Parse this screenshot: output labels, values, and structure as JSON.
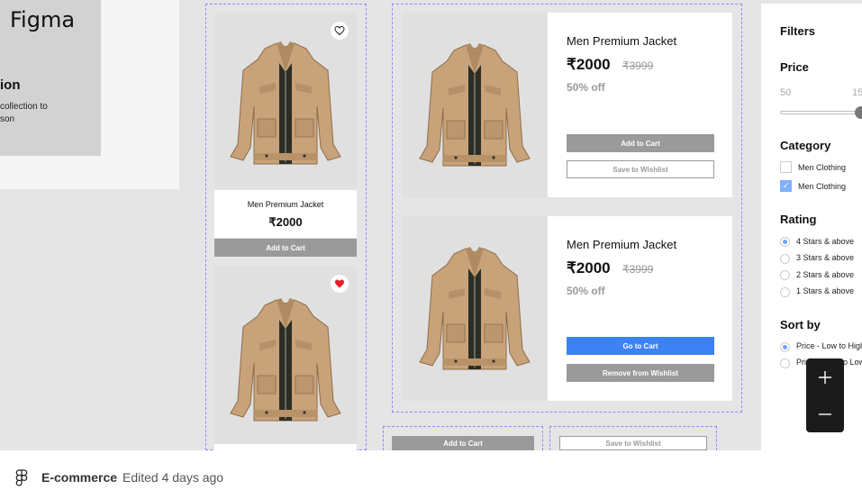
{
  "hero": {
    "logo": "Figma",
    "title": "ion",
    "line1": "collection to",
    "line2": "son"
  },
  "product_grid": {
    "cards": [
      {
        "name": "Men Premium Jacket",
        "price": "₹2000",
        "button": "Add to Cart",
        "favorite": false
      },
      {
        "name": "",
        "price": "",
        "button": "",
        "favorite": true
      }
    ]
  },
  "wishlist": {
    "cards": [
      {
        "name": "Men Premium Jacket",
        "price": "₹2000",
        "old_price": "₹3999",
        "discount": "50% off",
        "primary_button": "Add to Cart",
        "secondary_button": "Save to Wishlist"
      },
      {
        "name": "Men Premium Jacket",
        "price": "₹2000",
        "old_price": "₹3999",
        "discount": "50% off",
        "primary_button": "Go to Cart",
        "secondary_button": "Remove from Wishlist"
      }
    ]
  },
  "bottom_buttons": {
    "add_to_cart": "Add to Cart",
    "save_to_wishlist": "Save to Wishlist"
  },
  "filters": {
    "title": "Filters",
    "price": {
      "label": "Price",
      "min": "50",
      "max": "15"
    },
    "category": {
      "label": "Category",
      "items": [
        {
          "label": "Men Clothing",
          "checked": false
        },
        {
          "label": "Men Clothing",
          "checked": true
        }
      ]
    },
    "rating": {
      "label": "Rating",
      "items": [
        {
          "label": "4 Stars & above",
          "selected": true
        },
        {
          "label": "3 Stars & above",
          "selected": false
        },
        {
          "label": "2 Stars & above",
          "selected": false
        },
        {
          "label": "1 Stars & above",
          "selected": false
        }
      ]
    },
    "sort": {
      "label": "Sort by",
      "items": [
        {
          "label": "Price - Low to High",
          "selected": true
        },
        {
          "label": "Price - High to Low",
          "selected": false
        }
      ]
    }
  },
  "footer": {
    "file_name": "E-commerce",
    "edited": "Edited 4 days ago"
  },
  "colors": {
    "accent_blue": "#3d82f5",
    "heart_red": "#e8202a",
    "button_grey": "#9a9a9a",
    "selection_dashed": "#8c8cff"
  }
}
